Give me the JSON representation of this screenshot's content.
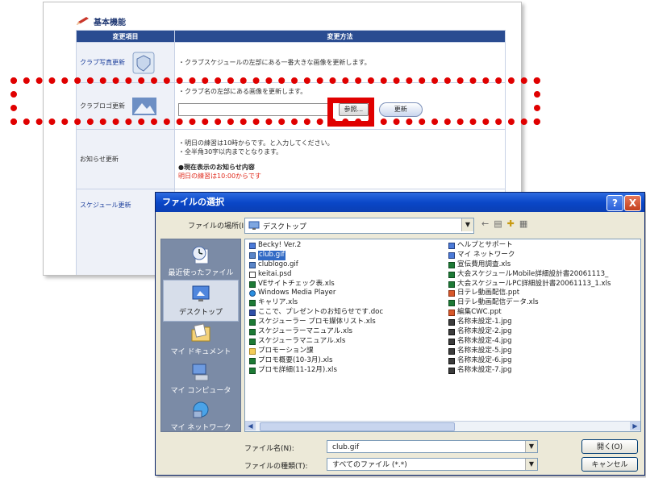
{
  "web": {
    "section_title": "基本機能",
    "col_item": "変更項目",
    "col_method": "変更方法",
    "rows": [
      {
        "label": "クラブ写真更新",
        "desc": "・クラブスケジュールの左部にある一番大きな画像を更新します。"
      },
      {
        "label": "クラブロゴ更新",
        "desc": "・クラブ名の左部にある画像を更新します。",
        "browse": "参照...",
        "update": "更新"
      },
      {
        "label": "お知らせ更新",
        "note1": "・明日の練習は10時からです。と入力してください。",
        "note2": "・全半角30字以内までとなります。",
        "current_head": "●現在表示のお知らせ内容",
        "current_text": "明日の練習は10:00からです"
      },
      {
        "label": "スケジュール更新"
      }
    ]
  },
  "dialog": {
    "title": "ファイルの選択",
    "help_label": "?",
    "close_label": "X",
    "look_in_label": "ファイルの場所(I):",
    "look_in_value": "デスクトップ",
    "places": [
      {
        "label": "最近使ったファイル",
        "icon": "recent-icon"
      },
      {
        "label": "デスクトップ",
        "icon": "desktop-icon"
      },
      {
        "label": "マイ ドキュメント",
        "icon": "my-documents-icon"
      },
      {
        "label": "マイ コンピュータ",
        "icon": "my-computer-icon"
      },
      {
        "label": "マイ ネットワーク",
        "icon": "my-network-icon"
      }
    ],
    "files_left": [
      {
        "name": "Becky! Ver.2",
        "type": "app"
      },
      {
        "name": "club.gif",
        "type": "gif",
        "selected": true
      },
      {
        "name": "clublogo.gif",
        "type": "gif"
      },
      {
        "name": "keitai.psd",
        "type": "psd"
      },
      {
        "name": "VEサイトチェック表.xls",
        "type": "xls"
      },
      {
        "name": "Windows Media Player",
        "type": "wmp"
      },
      {
        "name": "キャリア.xls",
        "type": "xls"
      },
      {
        "name": "ここで、プレゼントのお知らせです.doc",
        "type": "doc"
      },
      {
        "name": "スケジューラー プロモ媒体リスト.xls",
        "type": "xls"
      },
      {
        "name": "スケジューラーマニュアル.xls",
        "type": "xls"
      },
      {
        "name": "スケジューラマニュアル.xls",
        "type": "xls"
      },
      {
        "name": "プロモーション課",
        "type": "folder"
      },
      {
        "name": "プロモ概要(10-3月).xls",
        "type": "xls"
      },
      {
        "name": "プロモ詳細(11-12月).xls",
        "type": "xls"
      }
    ],
    "files_right": [
      {
        "name": "ヘルプとサポート",
        "type": "app"
      },
      {
        "name": "マイ ネットワーク",
        "type": "app"
      },
      {
        "name": "宣伝費用調査.xls",
        "type": "xls"
      },
      {
        "name": "大会スケジュールMobile詳細設計書20061113_",
        "type": "xls"
      },
      {
        "name": "大会スケジュールPC詳細設計書20061113_1.xls",
        "type": "xls"
      },
      {
        "name": "日テレ動画配信.ppt",
        "type": "ppt"
      },
      {
        "name": "日テレ動画配信データ.xls",
        "type": "xls"
      },
      {
        "name": "編集CWC.ppt",
        "type": "ppt"
      },
      {
        "name": "名称未設定-1.jpg",
        "type": "jpg"
      },
      {
        "name": "名称未設定-2.jpg",
        "type": "jpg"
      },
      {
        "name": "名称未設定-4.jpg",
        "type": "jpg"
      },
      {
        "name": "名称未設定-5.jpg",
        "type": "jpg"
      },
      {
        "name": "名称未設定-6.jpg",
        "type": "jpg"
      },
      {
        "name": "名称未設定-7.jpg",
        "type": "jpg"
      }
    ],
    "filename_label": "ファイル名(N):",
    "filename_value": "club.gif",
    "filetype_label": "ファイルの種類(T):",
    "filetype_value": "すべてのファイル (*.*)",
    "open_label": "開く(O)",
    "cancel_label": "キャンセル"
  },
  "colors": {
    "highlight": "#e00000",
    "titlebar": "#0a47c8",
    "table_header": "#2a4c91"
  }
}
